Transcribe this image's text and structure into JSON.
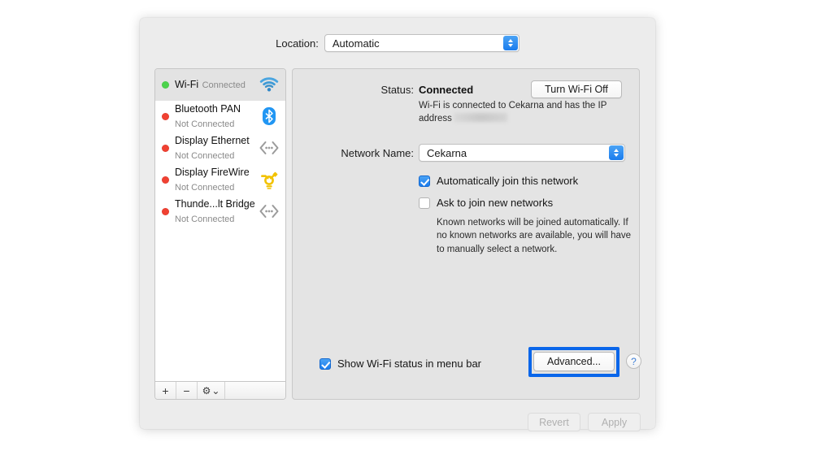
{
  "window": {
    "location": {
      "label": "Location:",
      "value": "Automatic"
    }
  },
  "sidebar": {
    "services": [
      {
        "name": "Wi-Fi",
        "status": "Connected",
        "state": "connected",
        "icon": "wifi-icon",
        "selected": true
      },
      {
        "name": "Bluetooth PAN",
        "status": "Not Connected",
        "state": "not-connected",
        "icon": "bluetooth-icon",
        "selected": false
      },
      {
        "name": "Display Ethernet",
        "status": "Not Connected",
        "state": "not-connected",
        "icon": "ethernet-icon",
        "selected": false
      },
      {
        "name": "Display FireWire",
        "status": "Not Connected",
        "state": "not-connected",
        "icon": "firewire-icon",
        "selected": false
      },
      {
        "name": "Thunde...lt Bridge",
        "status": "Not Connected",
        "state": "not-connected",
        "icon": "thunderbolt-bridge-icon",
        "selected": false
      }
    ],
    "toolbar": {
      "add": "+",
      "remove": "−",
      "gear": "⚙",
      "gear_chevron": "⌄"
    }
  },
  "main": {
    "status": {
      "label": "Status:",
      "value": "Connected",
      "description_before": "Wi-Fi is connected to Cekarna and has the IP address",
      "ip_address_redacted": true
    },
    "turn_wifi_off_button": "Turn Wi-Fi Off",
    "network_name": {
      "label": "Network Name:",
      "value": "Cekarna"
    },
    "auto_join": {
      "label": "Automatically join this network",
      "checked": true
    },
    "ask_join": {
      "label": "Ask to join new networks",
      "checked": false
    },
    "known_networks_note": "Known networks will be joined automatically. If no known networks are available, you will have to manually select a network.",
    "show_status": {
      "label": "Show Wi-Fi status in menu bar",
      "checked": true
    },
    "advanced_button": "Advanced...",
    "help_button": "?"
  },
  "footer": {
    "revert": "Revert",
    "apply": "Apply"
  },
  "colors": {
    "accent_blue": "#1a7ced",
    "highlight_blue": "#0a66ea",
    "connected_green": "#4cd34c",
    "disconnected_red": "#f04132",
    "window_bg": "#ececec",
    "panel_bg": "#e4e4e4"
  }
}
